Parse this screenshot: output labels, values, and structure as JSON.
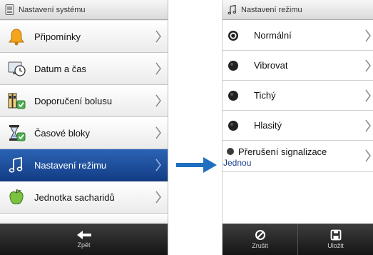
{
  "left_screen": {
    "title": "Nastavení systému",
    "items": [
      {
        "label": "Připomínky",
        "icon": "bell-icon"
      },
      {
        "label": "Datum a čas",
        "icon": "clock-monitor-icon"
      },
      {
        "label": "Doporučení bolusu",
        "icon": "bolus-advice-icon"
      },
      {
        "label": "Časové bloky",
        "icon": "hourglass-icon"
      },
      {
        "label": "Nastavení režimu",
        "icon": "music-note-icon",
        "selected": true
      },
      {
        "label": "Jednotka sacharidů",
        "icon": "apple-icon"
      }
    ],
    "bottom": {
      "back_label": "Zpět"
    }
  },
  "right_screen": {
    "title": "Nastavení režimu",
    "options": [
      {
        "label": "Normální",
        "selected": true
      },
      {
        "label": "Vibrovat",
        "selected": false
      },
      {
        "label": "Tichý",
        "selected": false
      },
      {
        "label": "Hlasitý",
        "selected": false
      }
    ],
    "signal_pause": {
      "label": "Přerušení signalizace",
      "value": "Jednou"
    },
    "bottom": {
      "cancel_label": "Zrušit",
      "save_label": "Uložit"
    }
  },
  "colors": {
    "selected_row": "#1e4fa0",
    "arrow": "#1f6fc0",
    "bottom_bar": "#2a2a2a"
  }
}
